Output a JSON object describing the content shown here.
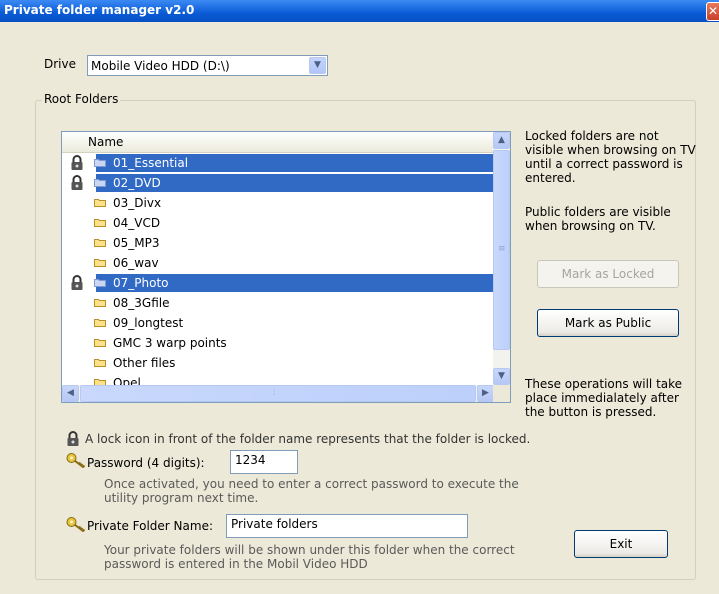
{
  "window": {
    "title": "Private folder manager v2.0",
    "close_glyph": "✕"
  },
  "drive": {
    "label": "Drive",
    "value": "Mobile Video HDD (D:\\)"
  },
  "root_folders": {
    "caption": "Root Folders",
    "column_header": "Name",
    "folders": [
      {
        "name": "01_Essential",
        "locked": true,
        "selected": true
      },
      {
        "name": "02_DVD",
        "locked": true,
        "selected": true
      },
      {
        "name": "03_Divx",
        "locked": false,
        "selected": false
      },
      {
        "name": "04_VCD",
        "locked": false,
        "selected": false
      },
      {
        "name": "05_MP3",
        "locked": false,
        "selected": false
      },
      {
        "name": "06_wav",
        "locked": false,
        "selected": false
      },
      {
        "name": "07_Photo",
        "locked": true,
        "selected": true
      },
      {
        "name": "08_3Gfile",
        "locked": false,
        "selected": false
      },
      {
        "name": "09_longtest",
        "locked": false,
        "selected": false
      },
      {
        "name": "GMC 3 warp points",
        "locked": false,
        "selected": false
      },
      {
        "name": "Other files",
        "locked": false,
        "selected": false
      },
      {
        "name": "Qpel",
        "locked": false,
        "selected": false
      }
    ]
  },
  "info": {
    "locked_note": "Locked folders are not visible when browsing on TV until a correct password is entered.",
    "public_note": "Public folders are visible when browsing on TV.",
    "operations_note": "These operations will take place immedialately after the button is pressed."
  },
  "buttons": {
    "mark_locked": "Mark as Locked",
    "mark_public": "Mark as Public",
    "exit": "Exit"
  },
  "lock_legend": "A lock icon in front of the folder name represents that the folder is locked.",
  "password": {
    "label": "Password (4 digits):",
    "value": "1234",
    "hint_line1": "Once activated, you need to enter a correct password to execute the",
    "hint_line2": "utility program next time."
  },
  "private_folder": {
    "label": "Private Folder Name:",
    "value": "Private folders",
    "hint_line1": "Your private folders will be shown under this folder when the correct",
    "hint_line2": "password is entered in the Mobil Video HDD"
  },
  "icons": {
    "lock": "padlock-icon",
    "folder": "folder-icon",
    "key": "key-icon",
    "dropdown": "chevron-down-icon",
    "scroll_up": "arrow-up-icon",
    "scroll_down": "arrow-down-icon",
    "scroll_left": "arrow-left-icon",
    "scroll_right": "arrow-right-icon"
  },
  "colors": {
    "selection": "#316ac5",
    "titlebar": "#0a5bd6",
    "window_bg": "#ece9d8"
  }
}
